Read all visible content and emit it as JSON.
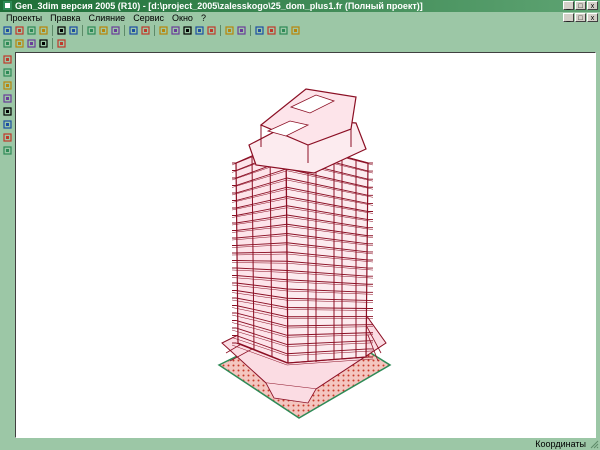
{
  "window": {
    "title": "Gen_3dim версия 2005 (R10) - [d:\\project_2005\\zalesskogo\\25_dom_plus1.fr (Полный проект)]",
    "controls": [
      "_",
      "□",
      "x"
    ]
  },
  "menu": {
    "items": [
      "Проекты",
      "Правка",
      "Слияние",
      "Сервис",
      "Окно",
      "?"
    ]
  },
  "mdi_controls": [
    "_",
    "□",
    "x"
  ],
  "toolbar1": {
    "icons": [
      "new-icon",
      "open-icon",
      "save-icon",
      "delete-icon",
      "sep",
      "print-icon",
      "preview-icon",
      "sep",
      "zoom-in-icon",
      "zoom-out-icon",
      "zoom-fit-icon",
      "sep",
      "select-icon",
      "dropdown-icon",
      "sep",
      "cube-icon",
      "check-icon",
      "check-dropdown-icon",
      "node-icon",
      "layers-icon",
      "sep",
      "arrow-icon",
      "mirror-icon",
      "sep",
      "grid-icon",
      "table-icon",
      "ruler-icon",
      "paint-icon"
    ]
  },
  "toolbar2": {
    "icons": [
      "view1-icon",
      "view2-icon",
      "view3-icon",
      "view4-icon",
      "sep",
      "tag-icon"
    ]
  },
  "left_toolbar": {
    "icons": [
      "tool-a-icon",
      "tool-b-icon",
      "tool-c-icon",
      "tool-d-icon",
      "tool-e-icon",
      "tool-f-icon",
      "tool-g-icon",
      "tool-h-icon"
    ]
  },
  "status": {
    "text": "Координаты"
  },
  "colors": {
    "chrome": "#9cc7a6",
    "title_dark": "#1d6f37",
    "building_line": "#8b0f24",
    "building_fill": "#fce4ea",
    "ground": "#c83a2a",
    "ground_edge": "#2e8b57"
  }
}
